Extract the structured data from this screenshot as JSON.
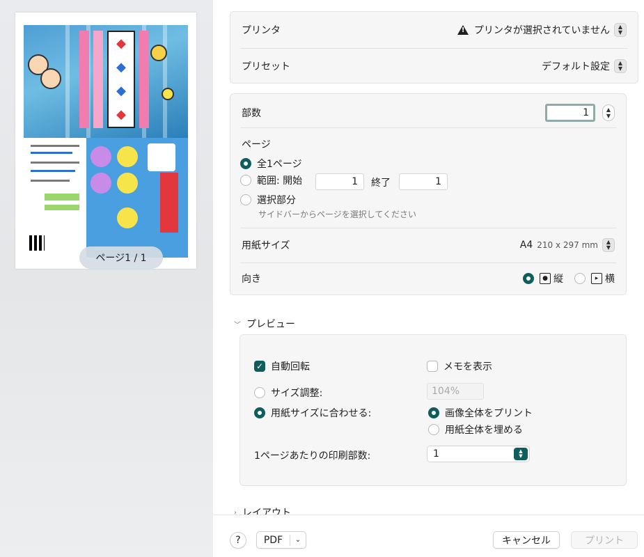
{
  "preview": {
    "page_indicator": "ページ1 / 1"
  },
  "printer": {
    "label": "プリンタ",
    "value": "プリンタが選択されていません",
    "warning_icon": "warning-triangle-icon"
  },
  "preset": {
    "label": "プリセット",
    "value": "デフォルト設定"
  },
  "copies": {
    "label": "部数",
    "value": "1"
  },
  "pages": {
    "label": "ページ",
    "all_label": "全1ページ",
    "range_label": "範囲: 開始",
    "range_start": "1",
    "range_end_label": "終了",
    "range_end": "1",
    "selection_label": "選択部分",
    "selection_hint": "サイドバーからページを選択してください",
    "selected": "all"
  },
  "paper_size": {
    "label": "用紙サイズ",
    "value": "A4",
    "dimensions": "210 x 297 mm"
  },
  "orientation": {
    "label": "向き",
    "portrait_label": "縦",
    "landscape_label": "横",
    "selected": "portrait"
  },
  "preview_section": {
    "title": "プレビュー",
    "auto_rotate_label": "自動回転",
    "auto_rotate_checked": true,
    "show_notes_label": "メモを表示",
    "show_notes_checked": false,
    "scale_label": "サイズ調整:",
    "scale_value": "104%",
    "fit_label": "用紙サイズに合わせる:",
    "fit_selected": true,
    "print_entire_label": "画像全体をプリント",
    "fill_paper_label": "用紙全体を埋める",
    "fit_mode": "print_entire",
    "copies_per_page_label": "1ページあたりの印刷部数:",
    "copies_per_page_value": "1"
  },
  "layout_section": {
    "title": "レイアウト"
  },
  "footer": {
    "help_label": "?",
    "pdf_label": "PDF",
    "cancel_label": "キャンセル",
    "print_label": "プリント"
  },
  "colors": {
    "accent": "#0f5d5c",
    "focus_ring": "#8faaa9"
  }
}
